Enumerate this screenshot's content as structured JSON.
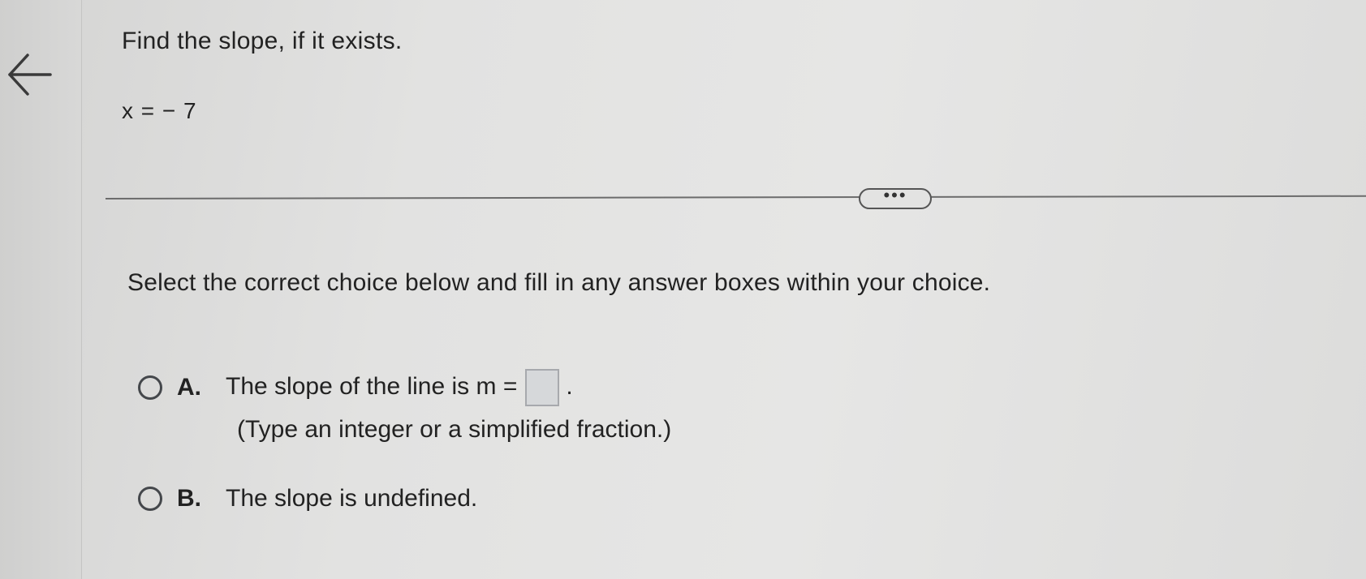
{
  "question": {
    "title": "Find the slope, if it exists.",
    "equation": "x = − 7"
  },
  "divider": {
    "more_label": "•••"
  },
  "instruction": "Select the correct choice below and fill in any answer boxes within your choice.",
  "choices": [
    {
      "letter": "A.",
      "text_before": "The slope of the line is m =",
      "text_after": ".",
      "answer_value": "",
      "hint": "(Type an integer or a simplified fraction.)",
      "selected": false
    },
    {
      "letter": "B.",
      "text": "The slope is undefined.",
      "selected": false
    }
  ],
  "icons": {
    "back": "arrow-left-icon"
  },
  "colors": {
    "background": "#e2e2e1",
    "text": "#222222",
    "radio_border": "#44474b",
    "answer_box_fill": "#d6d8da"
  }
}
